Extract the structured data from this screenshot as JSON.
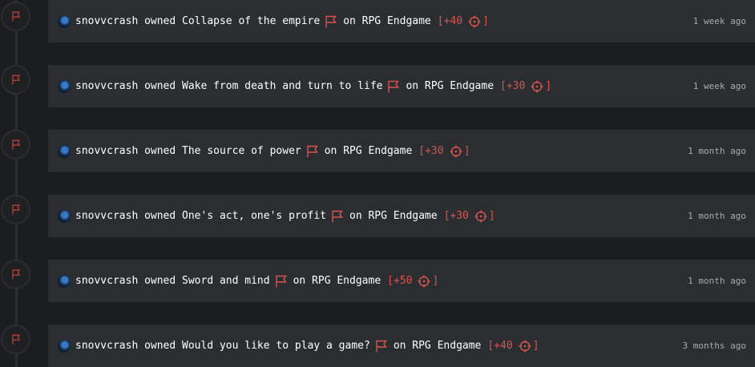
{
  "icons": {
    "avatar": "avatar-icon",
    "timeline": "flag-icon",
    "achievement": "flag-icon",
    "points": "crosshair-icon"
  },
  "colors": {
    "background": "#1b1d1f",
    "card": "#2b2e31",
    "accent_red": "#d9534f",
    "text": "#ffffff",
    "muted_text": "#a8acb0"
  },
  "feed": [
    {
      "user": "snovvcrash",
      "verb": "owned",
      "achievement": "Collapse of the empire",
      "preposition": "on",
      "game": "RPG Endgame",
      "points_open": "[+40",
      "points_close": "]",
      "time": "1 week ago"
    },
    {
      "user": "snovvcrash",
      "verb": "owned",
      "achievement": "Wake from death and turn to life",
      "preposition": "on",
      "game": "RPG Endgame",
      "points_open": "[+30",
      "points_close": "]",
      "time": "1 week ago"
    },
    {
      "user": "snovvcrash",
      "verb": "owned",
      "achievement": "The source of power",
      "preposition": "on",
      "game": "RPG Endgame",
      "points_open": "[+30",
      "points_close": "]",
      "time": "1 month ago"
    },
    {
      "user": "snovvcrash",
      "verb": "owned",
      "achievement": "One's act, one's profit",
      "preposition": "on",
      "game": "RPG Endgame",
      "points_open": "[+30",
      "points_close": "]",
      "time": "1 month ago"
    },
    {
      "user": "snovvcrash",
      "verb": "owned",
      "achievement": "Sword and mind",
      "preposition": "on",
      "game": "RPG Endgame",
      "points_open": "[+50",
      "points_close": "]",
      "time": "1 month ago"
    },
    {
      "user": "snovvcrash",
      "verb": "owned",
      "achievement": "Would you like to play a game?",
      "preposition": "on",
      "game": "RPG Endgame",
      "points_open": "[+40",
      "points_close": "]",
      "time": "3 months ago"
    }
  ]
}
